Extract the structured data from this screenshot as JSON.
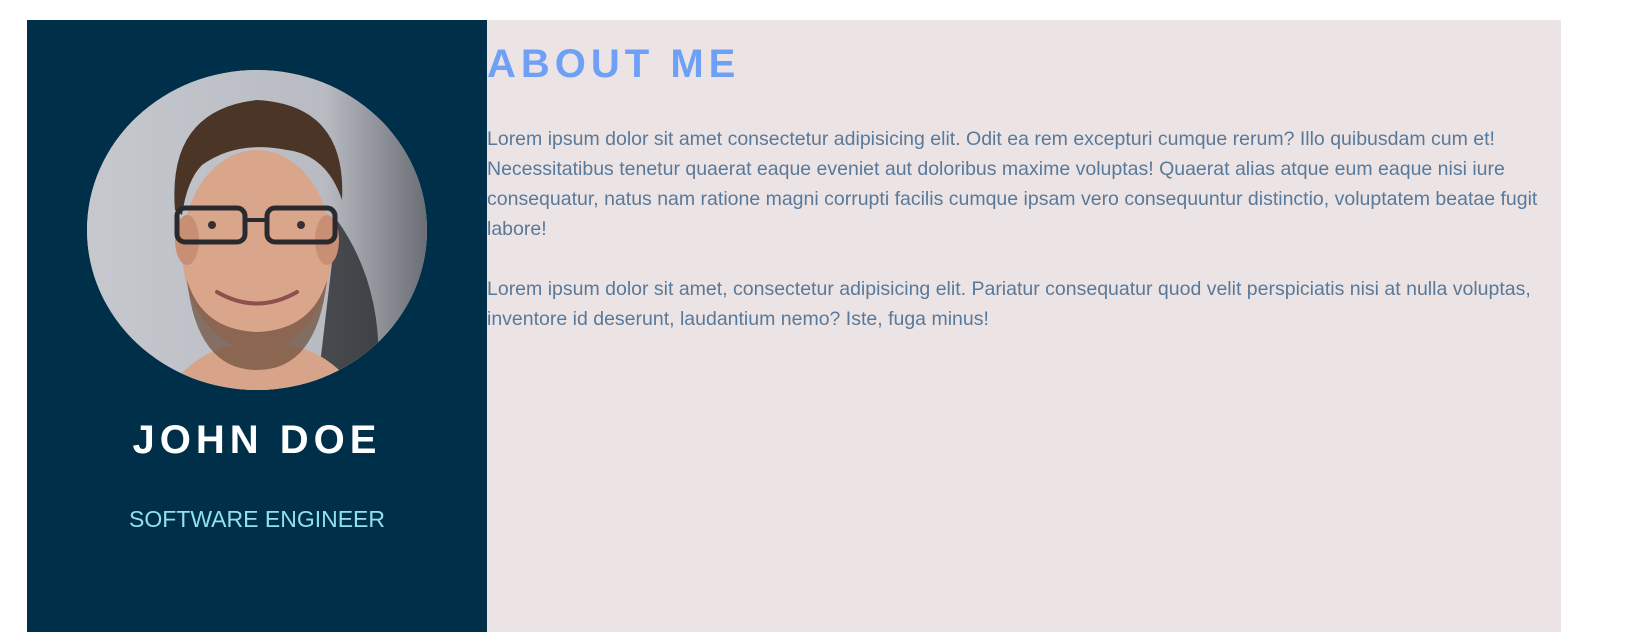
{
  "profile": {
    "name": "JOHN DOE",
    "role": "SOFTWARE ENGINEER",
    "avatar_alt": "profile-photo"
  },
  "about": {
    "title": "ABOUT ME",
    "paragraphs": [
      "Lorem ipsum dolor sit amet consectetur adipisicing elit. Odit ea rem excepturi cumque rerum? Illo quibusdam cum et! Necessitatibus tenetur quaerat eaque eveniet aut doloribus maxime voluptas! Quaerat alias atque eum eaque nisi iure consequatur, natus nam ratione magni corrupti facilis cumque ipsam vero consequuntur distinctio, voluptatem beatae fugit labore!",
      "Lorem ipsum dolor sit amet, consectetur adipisicing elit. Pariatur consequatur quod velit perspiciatis nisi at nulla voluptas, inventore id deserunt, laudantium nemo? Iste, fuga minus!"
    ]
  },
  "colors": {
    "sidebar_bg": "#003049",
    "main_bg": "#ece4e4",
    "name_color": "#ffffff",
    "role_color": "#90e0ef",
    "title_color": "#6ea0f6",
    "text_color": "#59799a"
  }
}
